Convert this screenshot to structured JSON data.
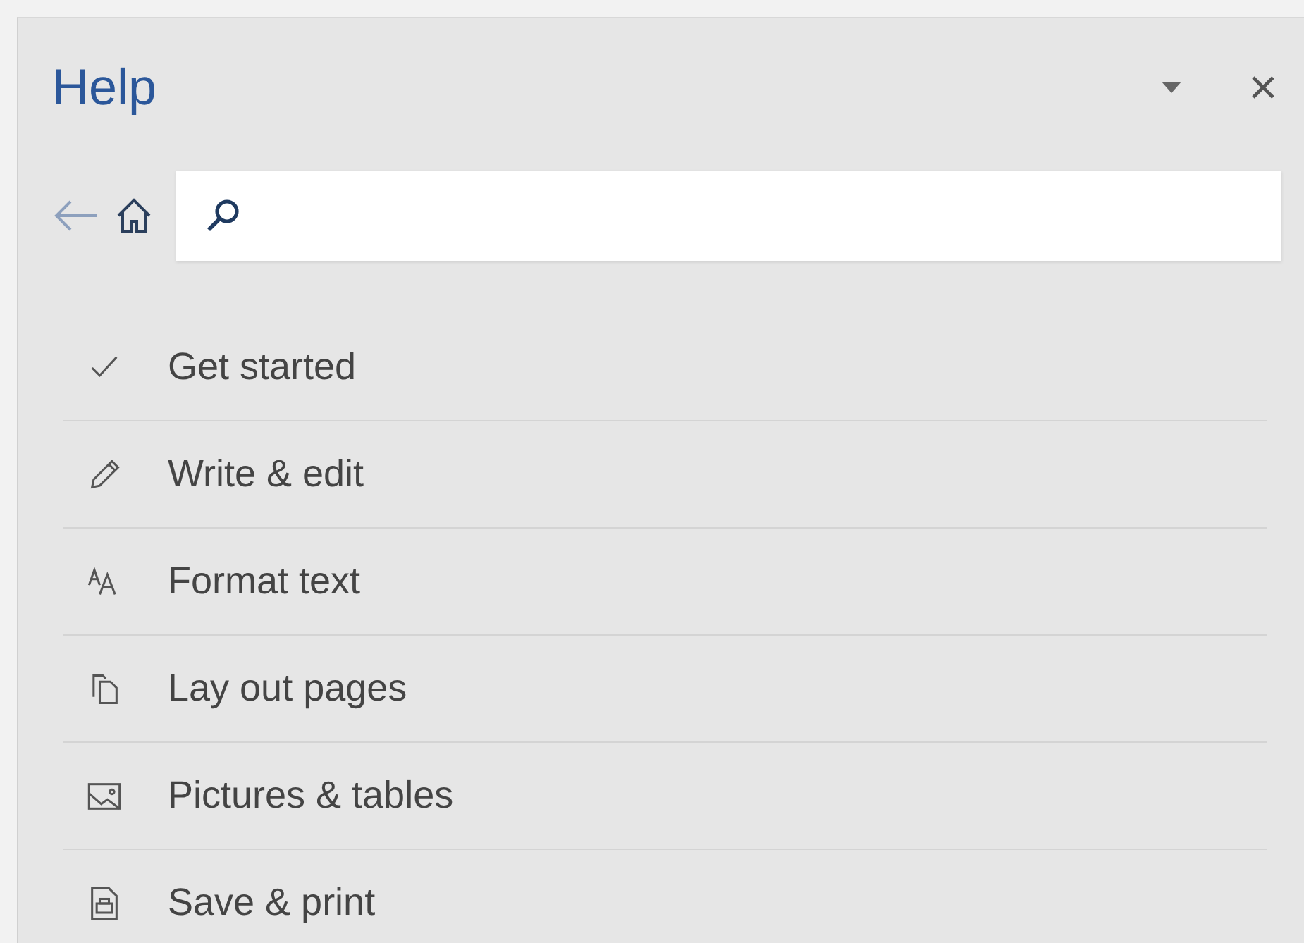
{
  "pane": {
    "title": "Help"
  },
  "topics": [
    {
      "kind": "check",
      "label": "Get started"
    },
    {
      "kind": "pencil",
      "label": "Write & edit"
    },
    {
      "kind": "font",
      "label": "Format text"
    },
    {
      "kind": "pages",
      "label": "Lay out pages"
    },
    {
      "kind": "image",
      "label": "Pictures & tables"
    },
    {
      "kind": "printer",
      "label": "Save & print"
    }
  ]
}
